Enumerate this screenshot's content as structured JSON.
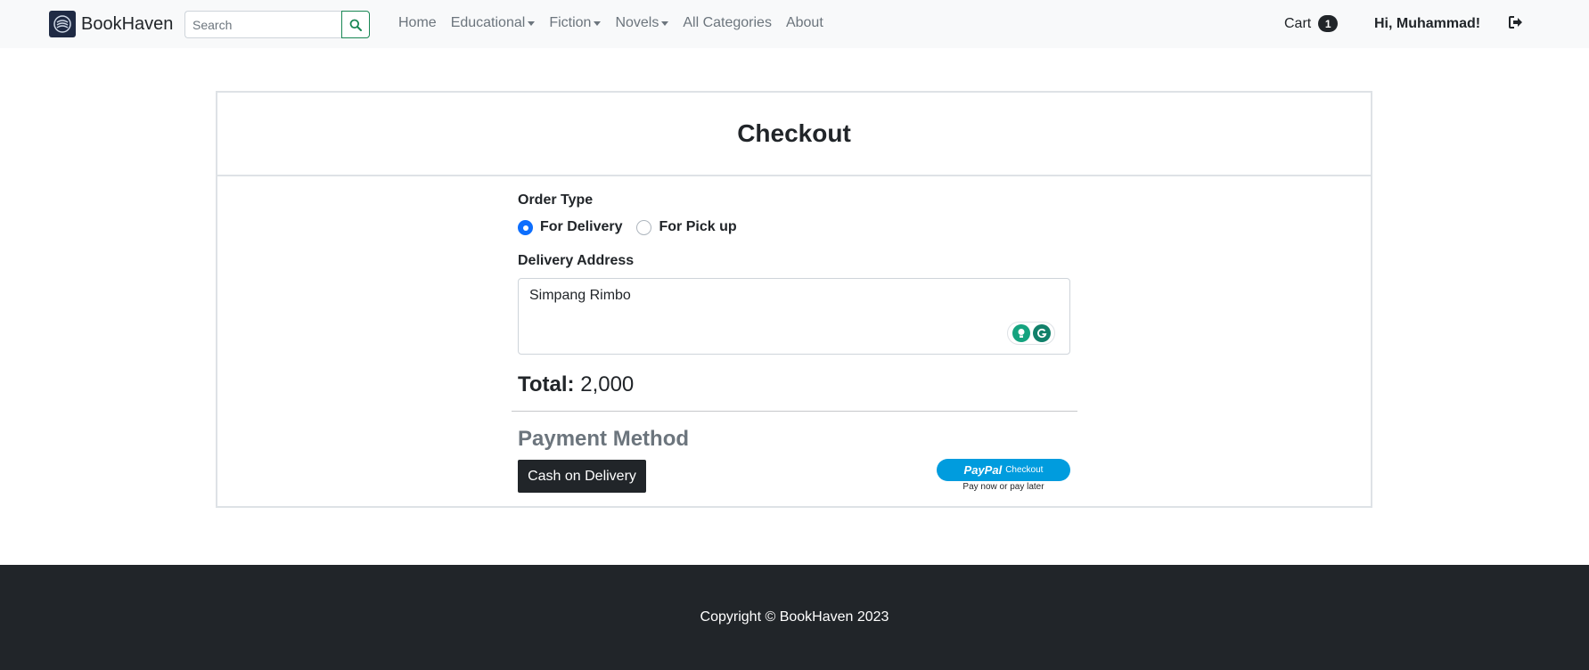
{
  "navbar": {
    "brand": "BookHaven",
    "search_placeholder": "Search",
    "links": [
      {
        "label": "Home",
        "dropdown": false
      },
      {
        "label": "Educational",
        "dropdown": true
      },
      {
        "label": "Fiction",
        "dropdown": true
      },
      {
        "label": "Novels",
        "dropdown": true
      },
      {
        "label": "All Categories",
        "dropdown": false
      },
      {
        "label": "About",
        "dropdown": false
      }
    ],
    "cart_label": "Cart",
    "cart_count": "1",
    "greeting": "Hi, Muhammad!",
    "icons": {
      "search": "search-icon",
      "logout": "logout-icon",
      "logo": "bookhaven-logo"
    }
  },
  "checkout": {
    "title": "Checkout",
    "order_type_label": "Order Type",
    "order_types": [
      {
        "label": "For Delivery",
        "checked": true
      },
      {
        "label": "For Pick up",
        "checked": false
      }
    ],
    "address_label": "Delivery Address",
    "address_value": "Simpang Rimbo",
    "total_label": "Total:",
    "total_value": "2,000",
    "payment_title": "Payment Method",
    "cod_label": "Cash on Delivery",
    "paypal_brand": "PayPal",
    "paypal_label": "Checkout",
    "paypal_tagline": "Pay now or pay later"
  },
  "footer": {
    "copyright": "Copyright © BookHaven 2023"
  },
  "colors": {
    "navbar_bg": "#f8f9fa",
    "footer_bg": "#212529",
    "primary": "#0d6efd",
    "search_border": "#198754",
    "paypal_blue": "#009cde"
  }
}
